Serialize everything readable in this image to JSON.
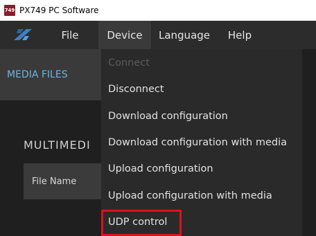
{
  "window": {
    "title": "PX749 PC Software",
    "icon_label": "749"
  },
  "menubar": {
    "items": [
      "File",
      "Device",
      "Language",
      "Help"
    ]
  },
  "left_panel": {
    "tab_label": "MEDIA FILES",
    "section_title": "MULTIMEDI",
    "column_header": "File Name"
  },
  "device_menu": {
    "items": [
      {
        "label": "Connect",
        "enabled": false
      },
      {
        "label": "Disconnect",
        "enabled": true
      },
      {
        "label": "Download configuration",
        "enabled": true
      },
      {
        "label": "Download configuration with media",
        "enabled": true
      },
      {
        "label": "Upload configuration",
        "enabled": true
      },
      {
        "label": "Upload configuration with media",
        "enabled": true
      },
      {
        "label": "UDP control",
        "enabled": true
      }
    ],
    "highlighted_item": "UDP control",
    "highlight_color": "#e0111b"
  },
  "colors": {
    "menubar_bg": "#2c2c2c",
    "dropdown_bg": "#2a2a2a",
    "accent_blue": "#67b6e8"
  }
}
